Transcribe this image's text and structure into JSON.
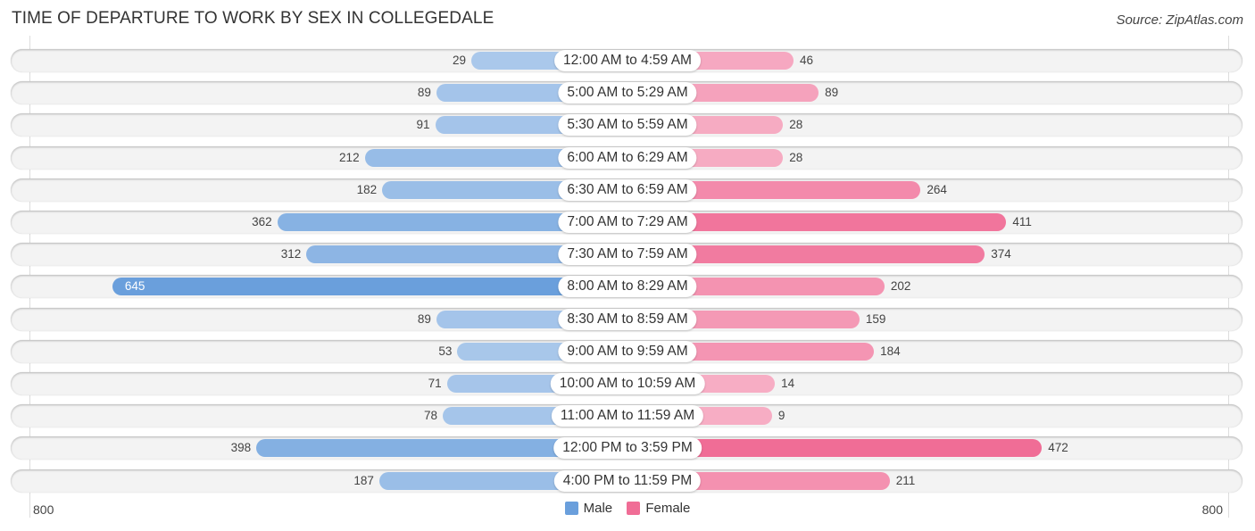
{
  "chart_data": {
    "type": "bar",
    "orientation": "horizontal-diverging",
    "title": "TIME OF DEPARTURE TO WORK BY SEX IN COLLEGEDALE",
    "source": "Source: ZipAtlas.com",
    "categories": [
      "12:00 AM to 4:59 AM",
      "5:00 AM to 5:29 AM",
      "5:30 AM to 5:59 AM",
      "6:00 AM to 6:29 AM",
      "6:30 AM to 6:59 AM",
      "7:00 AM to 7:29 AM",
      "7:30 AM to 7:59 AM",
      "8:00 AM to 8:29 AM",
      "8:30 AM to 8:59 AM",
      "9:00 AM to 9:59 AM",
      "10:00 AM to 10:59 AM",
      "11:00 AM to 11:59 AM",
      "12:00 PM to 3:59 PM",
      "4:00 PM to 11:59 PM"
    ],
    "series": [
      {
        "name": "Male",
        "color": "#6a9fdc",
        "values": [
          29,
          89,
          91,
          212,
          182,
          362,
          312,
          645,
          89,
          53,
          71,
          78,
          398,
          187
        ]
      },
      {
        "name": "Female",
        "color": "#f06d96",
        "values": [
          46,
          89,
          28,
          28,
          264,
          411,
          374,
          202,
          159,
          184,
          14,
          9,
          472,
          211
        ]
      }
    ],
    "axis": {
      "left_label": "800",
      "right_label": "800",
      "max": 800
    },
    "legend": {
      "position": "bottom-center",
      "items": [
        "Male",
        "Female"
      ]
    },
    "grid": false
  }
}
